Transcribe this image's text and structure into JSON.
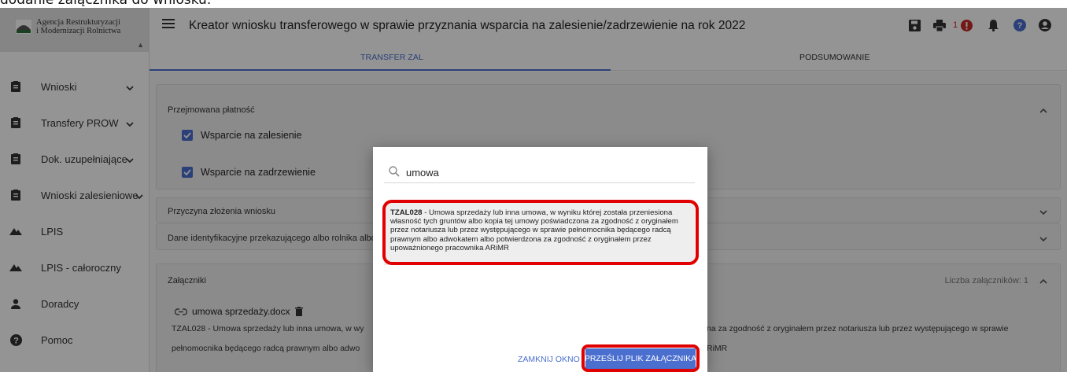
{
  "caption": "dodanie załącznika do wniosku.",
  "brand": {
    "line1": "Agencja Restrukturyzacji",
    "line2": "i Modernizacji Rolnictwa"
  },
  "nav": {
    "items": [
      {
        "label": "Wnioski",
        "icon": "clipboard-icon",
        "caret": true
      },
      {
        "label": "Transfery PROW",
        "icon": "clipboard-icon",
        "caret": true
      },
      {
        "label": "Dok. uzupełniające",
        "icon": "clipboard-icon",
        "caret": true
      },
      {
        "label": "Wnioski zalesieniowe",
        "icon": "clipboard-icon",
        "caret": true
      },
      {
        "label": "LPIS",
        "icon": "terrain-icon",
        "caret": false
      },
      {
        "label": "LPIS - całoroczny",
        "icon": "terrain-icon",
        "caret": false
      },
      {
        "label": "Doradcy",
        "icon": "person-icon",
        "caret": false
      },
      {
        "label": "Pomoc",
        "icon": "help-icon",
        "caret": false
      }
    ]
  },
  "header": {
    "title": "Kreator wniosku transferowego w sprawie przyznania wsparcia na zalesienie/zadrzewienie na rok 2022",
    "error_count": "1"
  },
  "tabs": [
    {
      "label": "TRANSFER ZAL",
      "active": true
    },
    {
      "label": "PODSUMOWANIE",
      "active": false
    }
  ],
  "panels": {
    "payment": {
      "title": "Przejmowana płatność",
      "options": [
        {
          "label": "Wsparcie na zalesienie",
          "checked": true
        },
        {
          "label": "Wsparcie na zadrzewienie",
          "checked": true
        }
      ]
    },
    "reason": {
      "title": "Przyczyna złożenia wniosku"
    },
    "identity": {
      "title": "Dane identyfikacyjne przekazującego albo rolnika albo"
    },
    "attachments": {
      "title": "Załączniki",
      "count_label": "Liczba załączników: 1",
      "file_name": "umowa sprzedaży.docx",
      "desc_left_1": "TZAL028 - Umowa sprzedaży lub inna umowa, w wy",
      "desc_left_2": "pełnomocnika będącego radcą prawnym albo adwo",
      "desc_right_1": "na za zgodność z oryginałem przez notariusza lub przez występującego w sprawie",
      "desc_right_2": "RiMR"
    }
  },
  "dialog": {
    "search_value": "umowa",
    "result_code": "TZAL028",
    "result_text": " - Umowa sprzedaży lub inna umowa, w wyniku której została przeniesiona własność tych gruntów albo kopia tej umowy poświadczona za zgodność z oryginałem przez notariusza lub przez występującego w sprawie pełnomocnika będącego radcą prawnym albo adwokatem albo potwierdzona za zgodność z oryginałem przez upoważnionego pracownika ARiMR",
    "close_label": "ZAMKNIJ OKNO",
    "upload_label": "PRZEŚLIJ PLIK ZAŁĄCZNIKA"
  },
  "colors": {
    "accent": "#4a6fcf",
    "highlight": "#e00000",
    "error": "#c62828"
  }
}
